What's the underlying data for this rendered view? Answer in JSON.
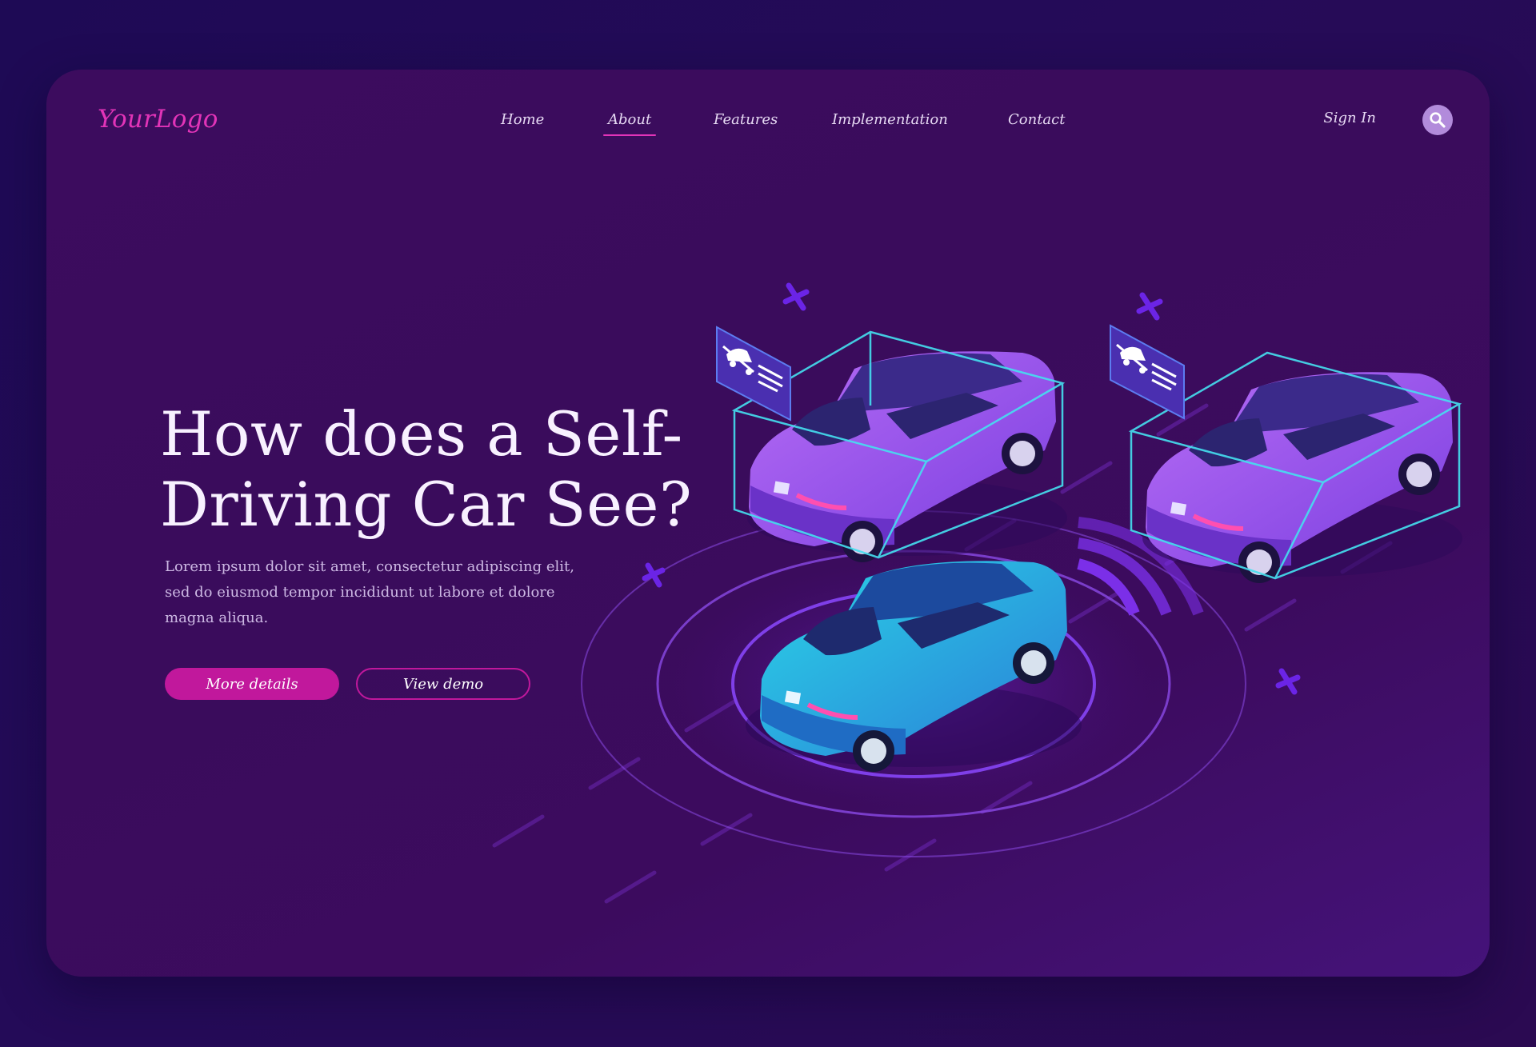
{
  "header": {
    "logo": "YourLogo",
    "nav": [
      {
        "label": "Home",
        "active": false
      },
      {
        "label": "About",
        "active": true
      },
      {
        "label": "Features",
        "active": false
      },
      {
        "label": "Implementation",
        "active": false
      },
      {
        "label": "Contact",
        "active": false
      }
    ],
    "sign_in": "Sign In",
    "search_icon": "search-icon"
  },
  "hero": {
    "title_line1": "How does a Self-",
    "title_line2": "Driving Car See?",
    "description": "Lorem ipsum dolor sit amet, consectetur adipiscing elit, sed do eiusmod tempor incididunt ut labore et dolore magna aliqua.",
    "primary_button": "More details",
    "secondary_button": "View demo"
  },
  "illustration": {
    "cars": [
      "blue-car",
      "purple-car",
      "purple-car"
    ],
    "detection_icon": "car-detection-icon"
  },
  "colors": {
    "accent": "#c1189c",
    "logo": "#e234b8",
    "detection_box": "#45e0f0",
    "background": "#3c0c5e"
  }
}
